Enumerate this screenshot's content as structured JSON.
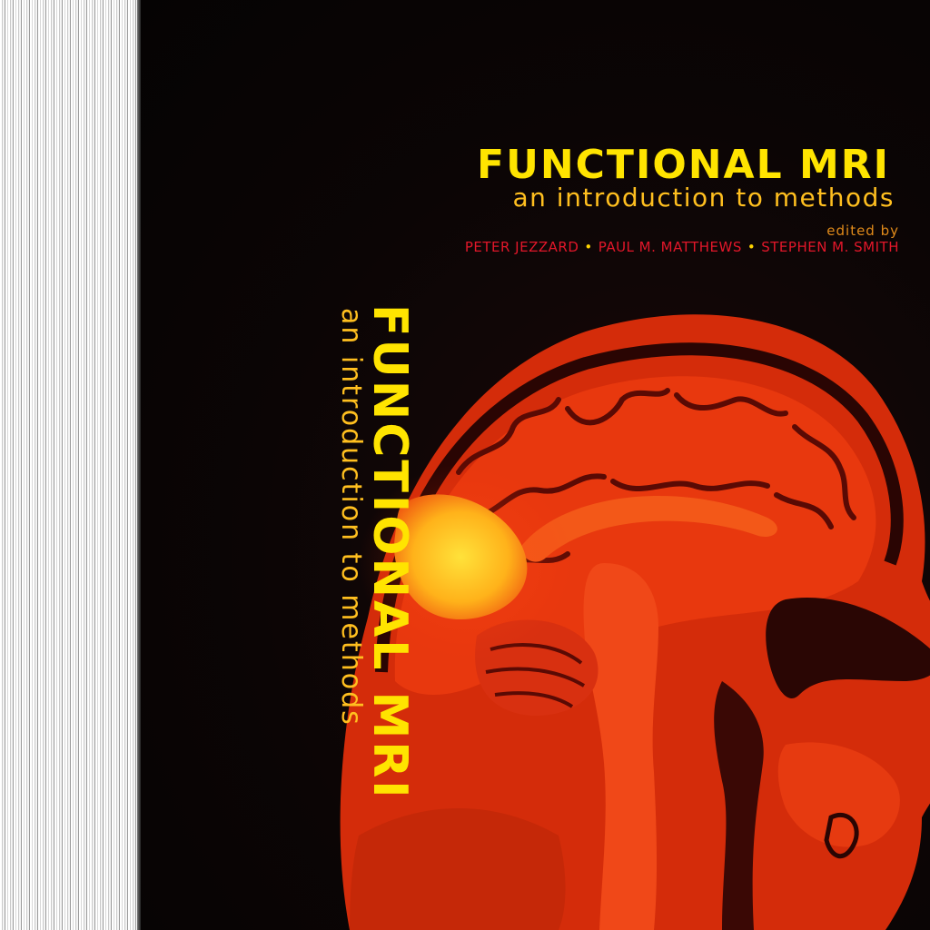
{
  "cover": {
    "title": "FUNCTIONAL MRI",
    "subtitle": "an introduction to methods",
    "edited_by": "edited by",
    "authors": [
      "PETER JEZZARD",
      "PAUL M. MATTHEWS",
      "STEPHEN M. SMITH"
    ]
  },
  "spine": {
    "title": "FUNCTIONAL MRI",
    "subtitle": "an introduction to methods"
  },
  "colors": {
    "background": "#0b0606",
    "title_yellow": "#ffe400",
    "subtitle_orange": "#ffbf1f",
    "author_red": "#e3172a",
    "scan_red": "#e8300c",
    "activation_yellow": "#ffd21a"
  },
  "illustration": "mri-sagittal-head-scan"
}
